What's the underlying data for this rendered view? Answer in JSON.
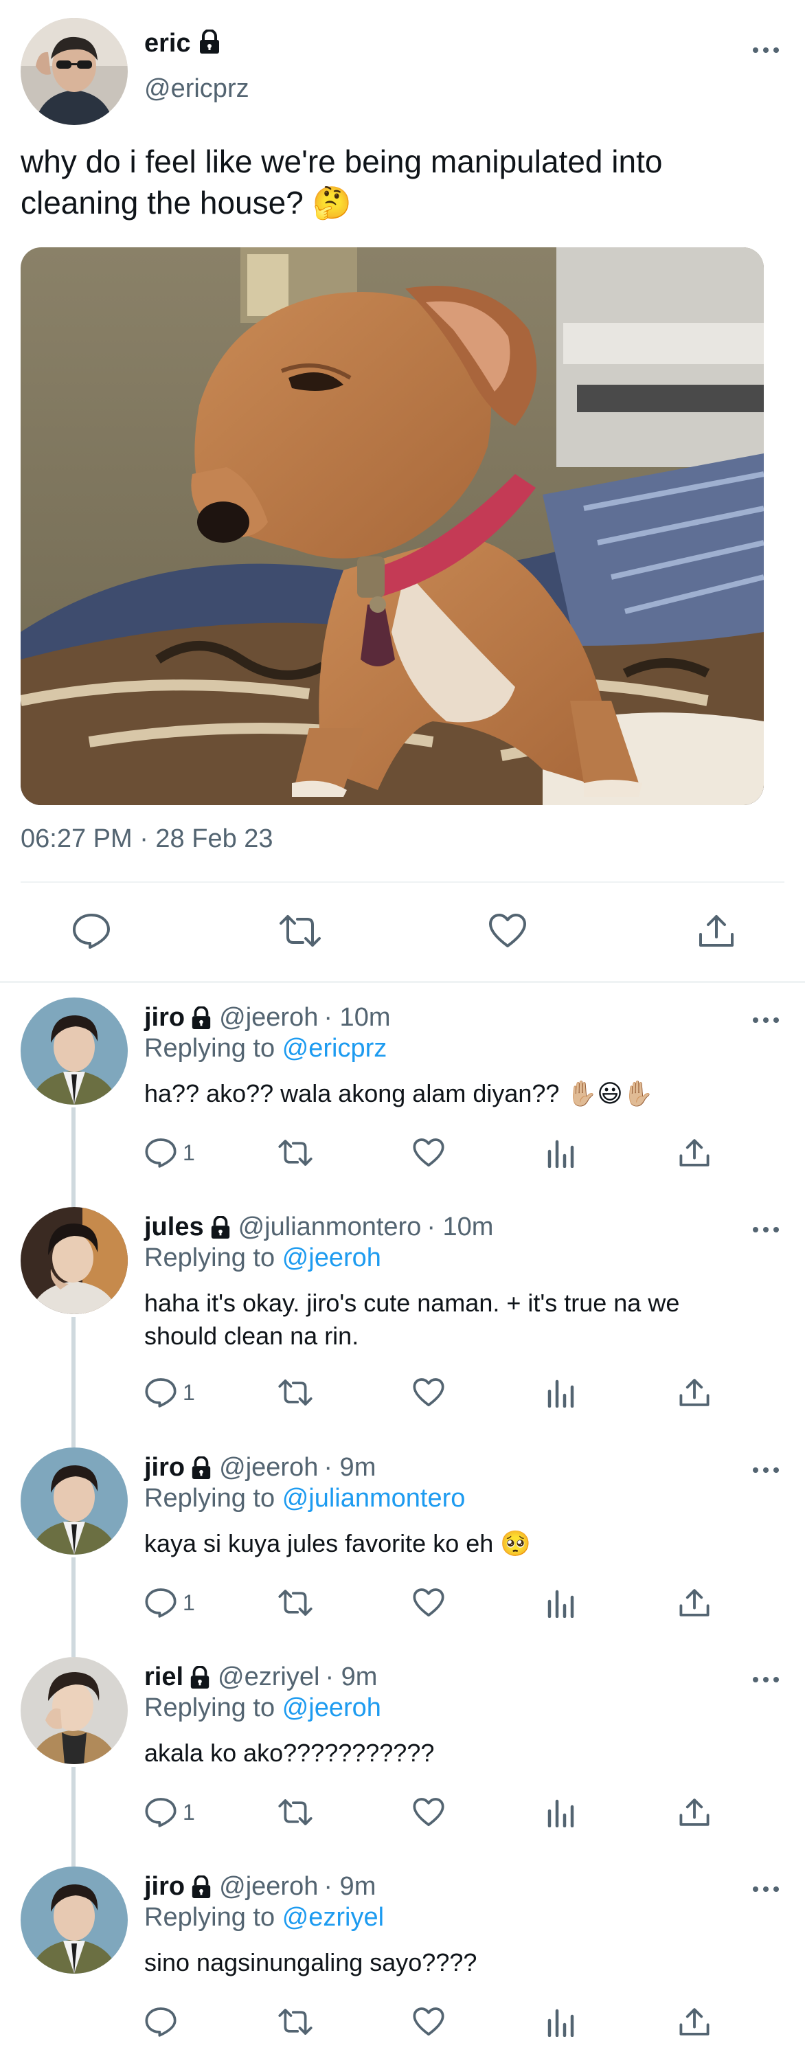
{
  "main_tweet": {
    "display_name": "eric",
    "handle": "@ericprz",
    "text": "why do i feel like we're being manipulated into cleaning the house? 🤔",
    "timestamp": "06:27 PM · 28 Feb 23",
    "more_icon": "ellipsis-icon",
    "actions": [
      "reply-icon",
      "retweet-icon",
      "like-icon",
      "share-icon"
    ]
  },
  "replies": [
    {
      "display_name": "jiro",
      "handle": "@jeeroh",
      "time": "· 10m",
      "replying_prefix": "Replying to",
      "replying_to": "@ericprz",
      "text": "ha?? ako?? wala akong alam diyan?? ✋🏼😃✋🏼",
      "reply_count": "1"
    },
    {
      "display_name": "jules",
      "handle": "@julianmontero",
      "time": "· 10m",
      "replying_prefix": "Replying to",
      "replying_to": "@jeeroh",
      "text": "haha it's okay. jiro's cute naman. + it's true na we should clean na rin.",
      "reply_count": "1"
    },
    {
      "display_name": "jiro",
      "handle": "@jeeroh",
      "time": "· 9m",
      "replying_prefix": "Replying to",
      "replying_to": "@julianmontero",
      "text": "kaya si kuya jules favorite ko eh 🥺",
      "reply_count": "1"
    },
    {
      "display_name": "riel",
      "handle": "@ezriyel",
      "time": "· 9m",
      "replying_prefix": "Replying to",
      "replying_to": "@jeeroh",
      "text": "akala ko ako???????????",
      "reply_count": "1"
    },
    {
      "display_name": "jiro",
      "handle": "@jeeroh",
      "time": "· 9m",
      "replying_prefix": "Replying to",
      "replying_to": "@ezriyel",
      "text": "sino nagsinungaling sayo????",
      "reply_count": ""
    }
  ],
  "colors": {
    "text": "#0f1419",
    "secondary": "#536471",
    "link": "#1d9bf0",
    "divider": "#eff3f4",
    "thread_line": "#cfd9de"
  }
}
